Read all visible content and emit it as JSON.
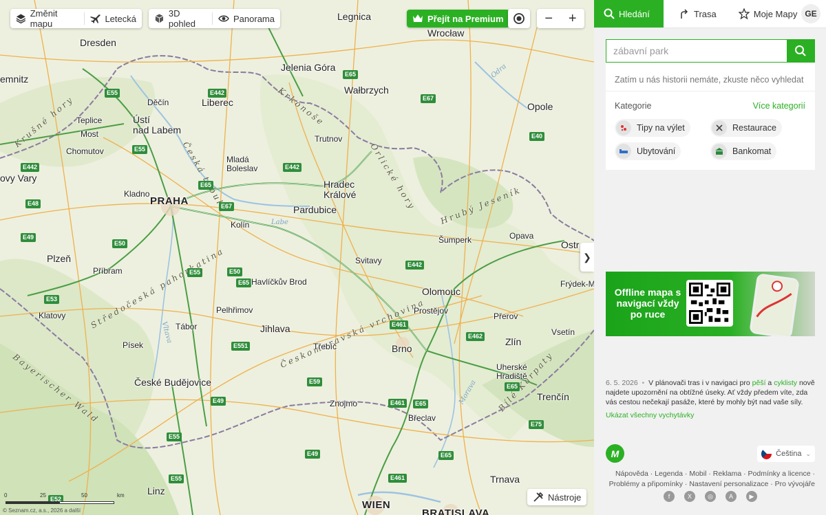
{
  "map": {
    "toolbar": {
      "change_map": "Změnit mapu",
      "aerial": "Letecká",
      "view_3d": "3D pohled",
      "panorama": "Panorama",
      "premium": "Přejít na Premium",
      "zoom_out": "−",
      "zoom_in": "+"
    },
    "tools_label": "Nástroje",
    "scale_labels": [
      "0",
      "25",
      "50",
      "km"
    ],
    "copyright": "© Seznam.cz, a.s., 2026 a další",
    "cities": [
      {
        "name": "Legnica",
        "size": "md"
      },
      {
        "name": "Wrocław",
        "size": "md"
      },
      {
        "name": "Dresden",
        "size": "md"
      },
      {
        "name": "Jelenia Góra",
        "size": "md"
      },
      {
        "name": "Wałbrzych",
        "size": "md"
      },
      {
        "name": "Opole",
        "size": "md"
      },
      {
        "name": "Děčín",
        "size": "sm"
      },
      {
        "name": "Liberec",
        "size": "md"
      },
      {
        "name": "Teplice",
        "size": "sm"
      },
      {
        "name": "Ústí\nnad Labem",
        "size": "md"
      },
      {
        "name": "Most",
        "size": "sm"
      },
      {
        "name": "Chomutov",
        "size": "sm"
      },
      {
        "name": "Trutnov",
        "size": "sm"
      },
      {
        "name": "Mladá\nBoleslav",
        "size": "sm"
      },
      {
        "name": "Hradec\nKrálové",
        "size": "md"
      },
      {
        "name": "Kladno",
        "size": "sm"
      },
      {
        "name": "PRAHA",
        "size": "lg"
      },
      {
        "name": "Pardubice",
        "size": "md"
      },
      {
        "name": "Kolín",
        "size": "sm"
      },
      {
        "name": "Šumperk",
        "size": "sm"
      },
      {
        "name": "Opava",
        "size": "sm"
      },
      {
        "name": "Ostr",
        "size": "md"
      },
      {
        "name": "Plzeň",
        "size": "md"
      },
      {
        "name": "Příbram",
        "size": "sm"
      },
      {
        "name": "Svitavy",
        "size": "sm"
      },
      {
        "name": "Havlíčkův Brod",
        "size": "sm"
      },
      {
        "name": "Olomouc",
        "size": "md"
      },
      {
        "name": "Frýdek-M",
        "size": "sm"
      },
      {
        "name": "Pelhřimov",
        "size": "sm"
      },
      {
        "name": "Prostějov",
        "size": "sm"
      },
      {
        "name": "Klatovy",
        "size": "sm"
      },
      {
        "name": "Tábor",
        "size": "sm"
      },
      {
        "name": "Jihlava",
        "size": "md"
      },
      {
        "name": "Přerov",
        "size": "sm"
      },
      {
        "name": "Vsetín",
        "size": "sm"
      },
      {
        "name": "Písek",
        "size": "sm"
      },
      {
        "name": "Třebíč",
        "size": "sm"
      },
      {
        "name": "Brno",
        "size": "md"
      },
      {
        "name": "Zlín",
        "size": "md"
      },
      {
        "name": "Uherské\nHradiště",
        "size": "sm"
      },
      {
        "name": "České Budějovice",
        "size": "md"
      },
      {
        "name": "Znojmo",
        "size": "sm"
      },
      {
        "name": "Trenčín",
        "size": "md"
      },
      {
        "name": "Břeclav",
        "size": "sm"
      },
      {
        "name": "Linz",
        "size": "md"
      },
      {
        "name": "Trnava",
        "size": "md"
      },
      {
        "name": "WIEN",
        "size": "lg"
      },
      {
        "name": "BRATISLAVA",
        "size": "lg"
      },
      {
        "name": "emnitz",
        "size": "md"
      },
      {
        "name": "ovy Vary",
        "size": "md"
      }
    ],
    "regions": [
      "Krkonoše",
      "Orlické hory",
      "Hrubý Jeseník",
      "Středočeská pahorkatina",
      "Českomoravská vrchovina",
      "Bayerischer Wald",
      "Bílé Karpaty",
      "Krušné hory",
      "Česká tabule"
    ],
    "rivers": [
      "Labe",
      "Odra",
      "Morava",
      "Vltava"
    ],
    "highways": [
      "E65",
      "E55",
      "E442",
      "E67",
      "E40",
      "E48",
      "E50",
      "E49",
      "E53",
      "E551",
      "E59",
      "E461",
      "E462",
      "E75",
      "E52"
    ]
  },
  "panel": {
    "tabs": {
      "search": "Hledání",
      "route": "Trasa",
      "my_maps": "Moje Mapy"
    },
    "avatar": "GE",
    "search": {
      "placeholder": "zábavní park"
    },
    "history_text": "Zatím u nás historii nemáte, zkuste něco vyhledat",
    "categories_title": "Kategorie",
    "categories_more": "Více kategorií",
    "categories": [
      {
        "label": "Tipy na výlet",
        "icon": "trip-icon"
      },
      {
        "label": "Restaurace",
        "icon": "restaurant-icon"
      },
      {
        "label": "Ubytování",
        "icon": "bed-icon"
      },
      {
        "label": "Bankomat",
        "icon": "atm-icon"
      }
    ],
    "banner": {
      "text": "Offline mapa s navigací vždy po ruce"
    },
    "news": {
      "date": "6. 5. 2026",
      "text_1": "V plánovači tras i v navigaci pro ",
      "link_1": "pěší",
      "text_2": " a ",
      "link_2": "cyklisty",
      "text_3": " nově najdete upozornění na obtížné úseky. Ať vždy předem víte, zda vás cestou nečekají pasáže, které by mohly být nad vaše síly.",
      "all": "Ukázat všechny vychytávky"
    },
    "logo": "M",
    "language": "Čeština",
    "footer_line_1": "Nápověda · Legenda · Mobil · Reklama · Podmínky a licence ·",
    "footer_line_2": "Problémy a připomínky · Nastavení personalizace · Pro vývojáře",
    "socials": [
      "f",
      "X",
      "◎",
      "A",
      "▶"
    ]
  }
}
